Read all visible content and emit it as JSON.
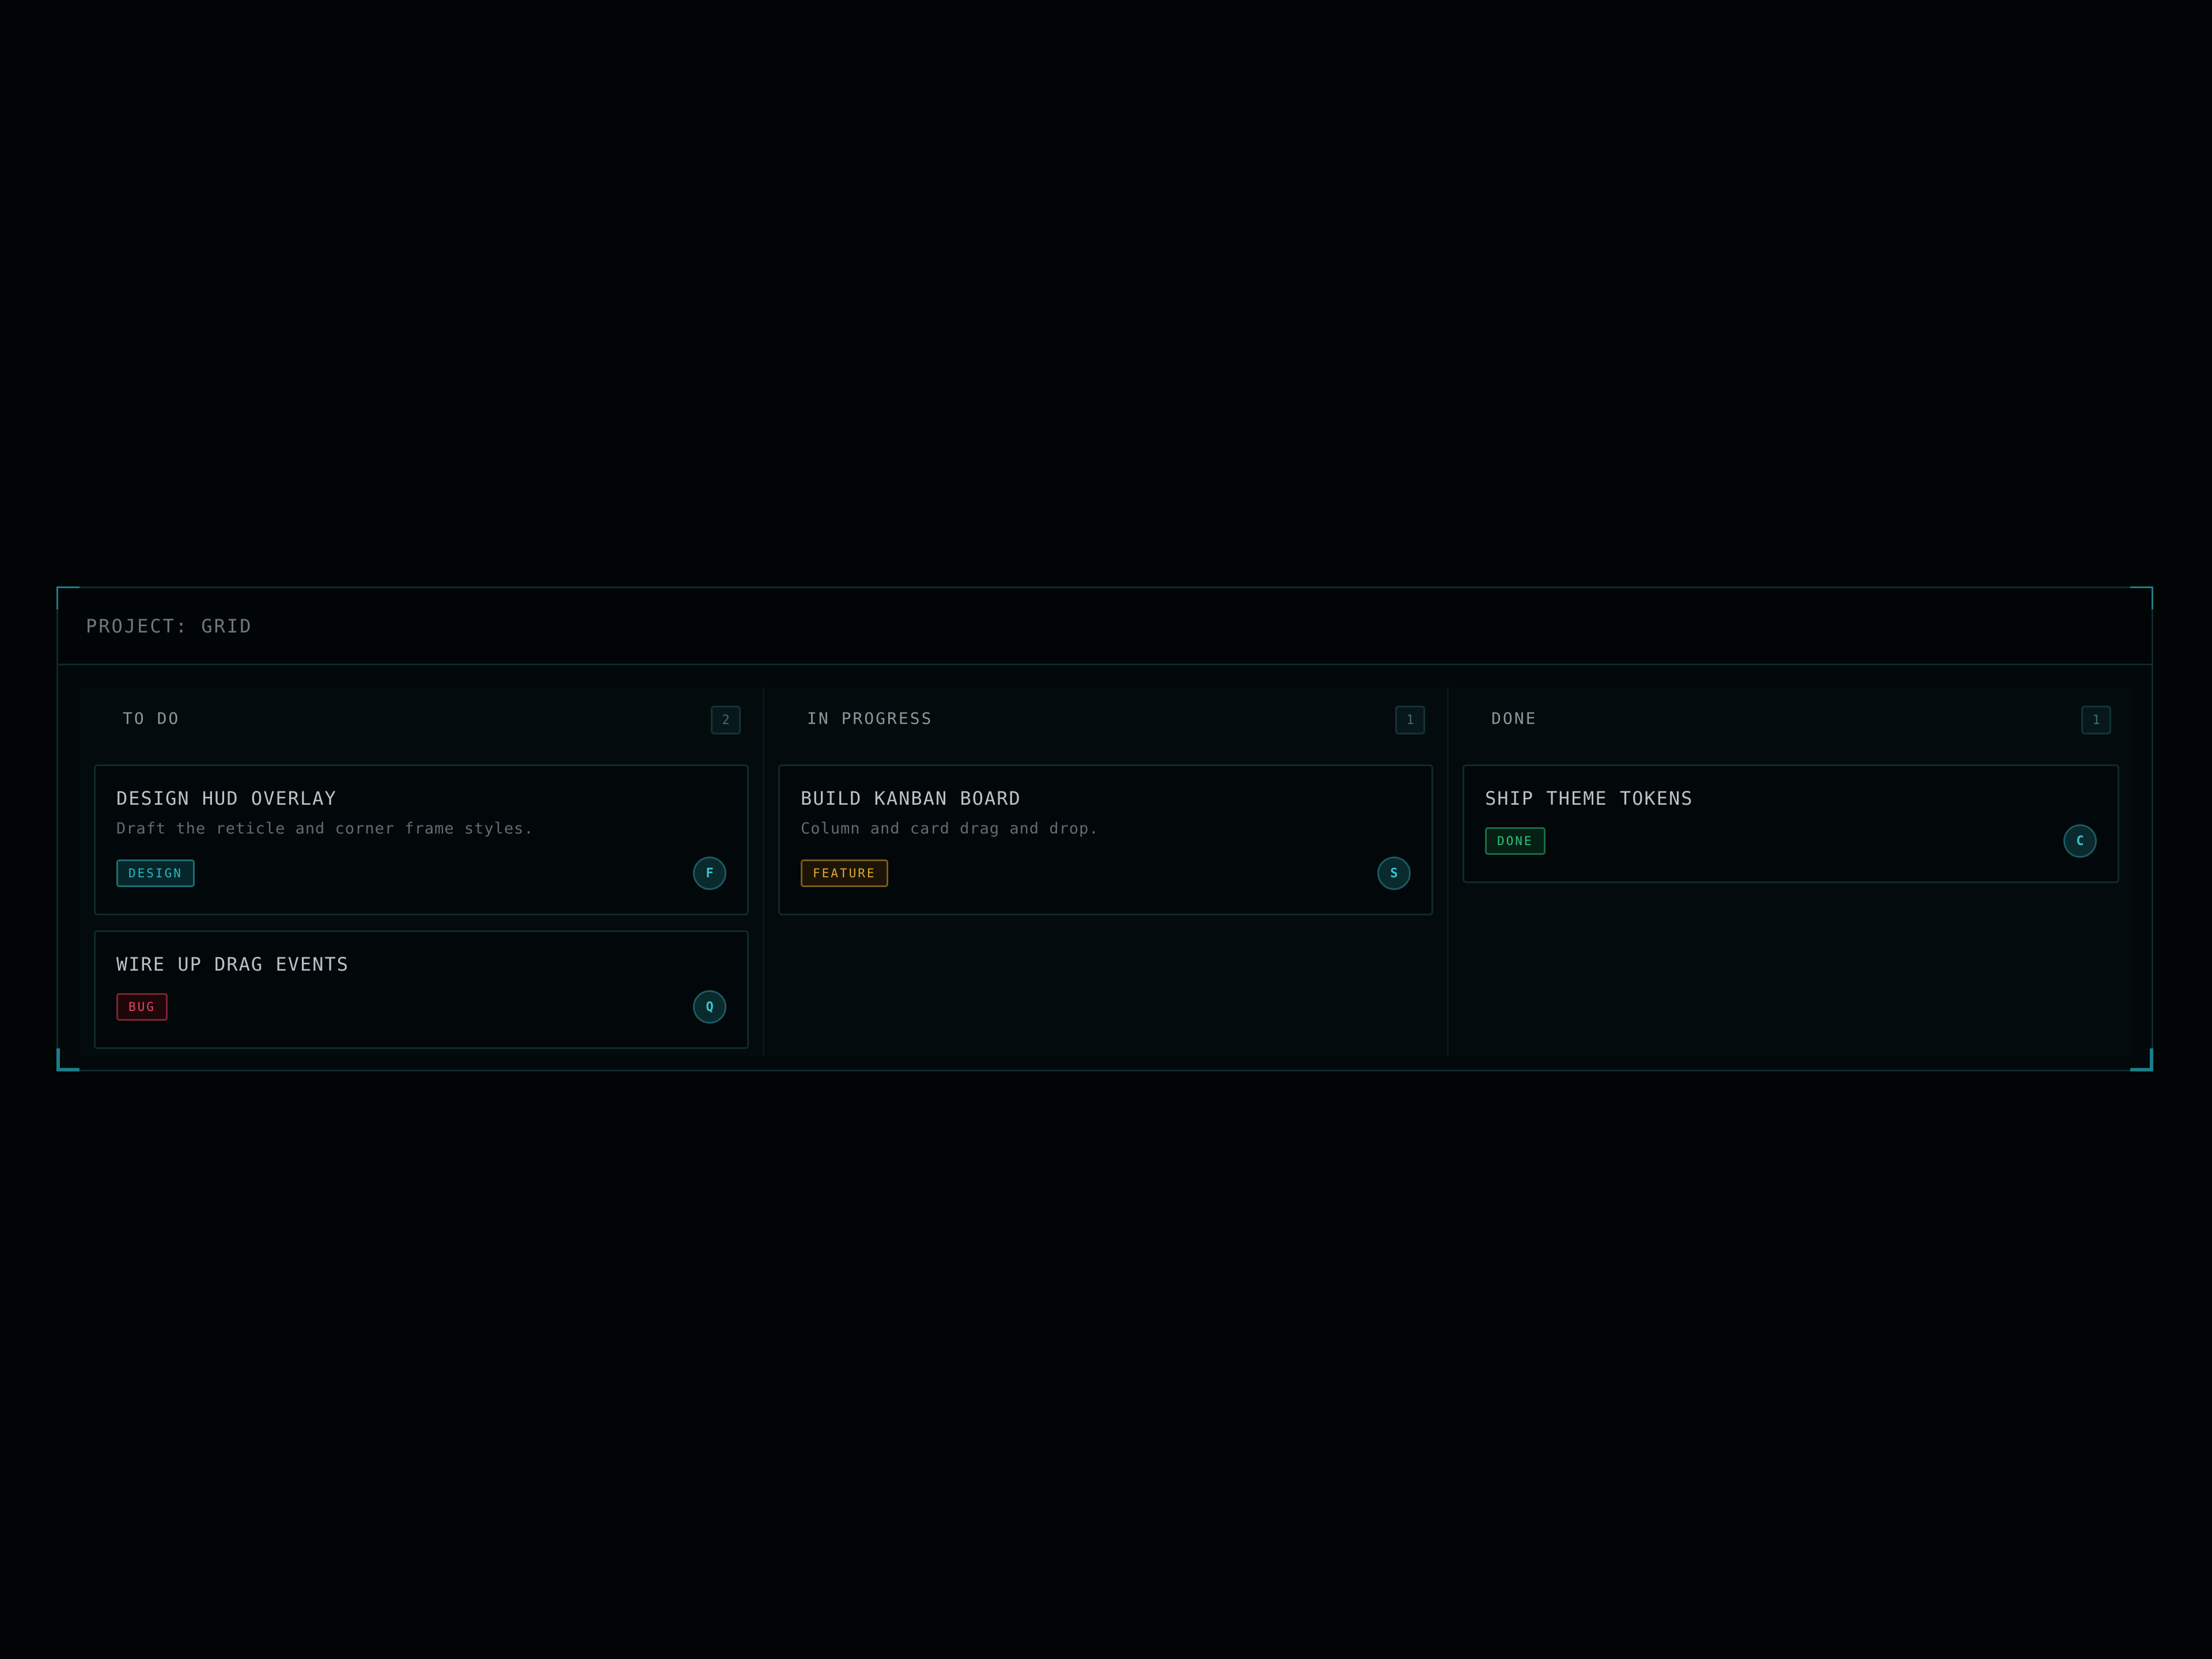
{
  "project": {
    "title": "PROJECT: GRID"
  },
  "columns": [
    {
      "title": "TO DO",
      "count": "2",
      "cards": [
        {
          "title": "DESIGN HUD OVERLAY",
          "description": "Draft the reticle and corner frame styles.",
          "tag": "DESIGN",
          "avatar": "F"
        },
        {
          "title": "WIRE UP DRAG EVENTS",
          "tag": "BUG",
          "avatar": "Q"
        }
      ]
    },
    {
      "title": "IN PROGRESS",
      "count": "1",
      "cards": [
        {
          "title": "BUILD KANBAN BOARD",
          "description": "Column and card drag and drop.",
          "tag": "FEATURE",
          "avatar": "S"
        }
      ]
    },
    {
      "title": "DONE",
      "count": "1",
      "cards": [
        {
          "title": "SHIP THEME TOKENS",
          "tag": "DONE",
          "avatar": "C"
        }
      ]
    }
  ],
  "colors": {
    "accent": "#1a7f88",
    "tag_design": "#2bb7c0",
    "tag_bug": "#e04a5a",
    "tag_feature": "#e0a73a",
    "tag_done": "#2cc47a"
  }
}
